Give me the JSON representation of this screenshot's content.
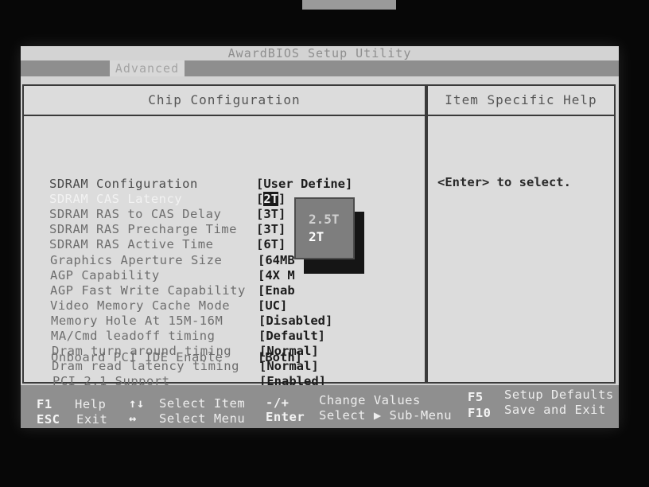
{
  "app": {
    "title": "AwardBIOS Setup Utility",
    "active_menu": "Advanced"
  },
  "left_panel": {
    "heading": "Chip Configuration",
    "items": [
      {
        "label": "SDRAM Configuration",
        "value": "[User Define]"
      },
      {
        "label": "SDRAM CAS Latency",
        "value_open": "[",
        "value_hl": "2T",
        "value_close": "]"
      },
      {
        "label": "SDRAM RAS to CAS Delay",
        "value": "[3T]"
      },
      {
        "label": "SDRAM RAS Precharge Time",
        "value": "[3T]"
      },
      {
        "label": "SDRAM RAS Active Time",
        "value": "[6T]"
      },
      {
        "label": "Graphics Aperture Size",
        "value": "[64MB"
      },
      {
        "label": "AGP Capability",
        "value": "[4X M"
      },
      {
        "label": "AGP Fast Write Capability",
        "value": "[Enab"
      },
      {
        "label": "Video Memory Cache Mode",
        "value": "[UC]"
      },
      {
        "label": "Memory Hole At 15M-16M",
        "value": "[Disabled]"
      },
      {
        "label": "MA/Cmd leadoff timing",
        "value": "[Default]"
      },
      {
        "label": "Dram turn around timing",
        "value": "[Normal]"
      },
      {
        "label": "Dram read latency timing",
        "value": "[Normal]"
      },
      {
        "label": "PCI 2.1 Support",
        "value": "[Enabled]"
      },
      {
        "label": "Onboard PCI IDE Enable",
        "value": "[Both]"
      }
    ]
  },
  "right_panel": {
    "heading": "Item Specific Help",
    "help": "<Enter> to select."
  },
  "popup": {
    "options": [
      "2.5T",
      "2T"
    ],
    "selected": "2T"
  },
  "footer": {
    "f1_key": "F1",
    "f1_label": "Help",
    "updown_key": "↑↓",
    "updown_label": "Select Item",
    "pm_key": "-/+",
    "pm_label": "Change Values",
    "f5_key": "F5",
    "f5_label": "Setup Defaults",
    "esc_key": "ESC",
    "esc_label": "Exit",
    "lr_key": "↔",
    "lr_label": "Select Menu",
    "enter_key": "Enter",
    "enter_label": "Select ▶ Sub-Menu",
    "f10_key": "F10",
    "f10_label": "Save and Exit"
  }
}
